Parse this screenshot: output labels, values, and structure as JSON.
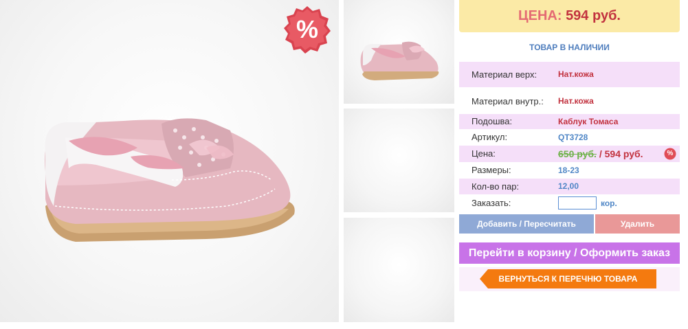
{
  "sale_badge": {
    "symbol": "%"
  },
  "price_header": {
    "label": "ЦЕНА:",
    "value": "594 руб."
  },
  "stock_status": "ТОВАР В НАЛИЧИИ",
  "details": {
    "material_top": {
      "label": "Материал верх:",
      "value": "Нат.кожа"
    },
    "material_inner": {
      "label": "Материал внутр.:",
      "value": "Нат.кожа"
    },
    "sole": {
      "label": "Подошва:",
      "value": "Каблук Томаса"
    },
    "article": {
      "label": "Артикул:",
      "value": "QT3728"
    },
    "price": {
      "label": "Цена:",
      "old_value": "650 руб.",
      "new_value": " / 594 руб.",
      "badge": "%"
    },
    "sizes": {
      "label": "Размеры:",
      "value": "18-23"
    },
    "pairs": {
      "label": "Кол-во пар:",
      "value": "12,00"
    },
    "order": {
      "label": "Заказать:",
      "input_value": "",
      "unit": "кор."
    }
  },
  "buttons": {
    "add": "Добавить / Пересчитать",
    "delete": "Удалить",
    "cart": "Перейти в корзину / Оформить заказ",
    "back": "ВЕРНУТЬСЯ К ПЕРЕЧНЮ ТОВАРА"
  },
  "colors": {
    "price_bg": "#fbeaa6",
    "row_highlight": "#f5dff9",
    "accent_red": "#c2323f",
    "accent_blue": "#4f86c6",
    "cart_button": "#c873e8",
    "back_button": "#f47a0f"
  }
}
